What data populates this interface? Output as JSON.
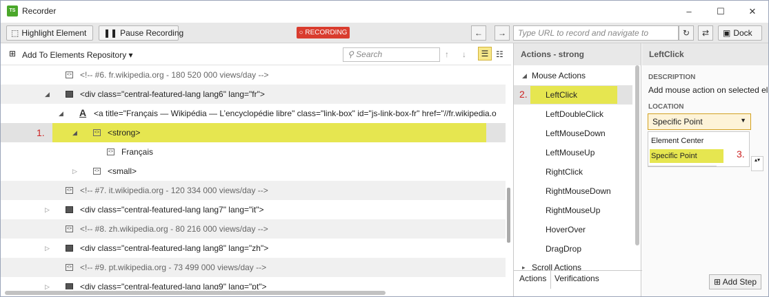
{
  "window": {
    "logo": "TS",
    "title": "Recorder",
    "minimize": "–",
    "maximize": "☐",
    "close": "✕"
  },
  "toolbar": {
    "highlight": "Highlight Element",
    "pause": "Pause Recording",
    "recording": "RECORDING",
    "url_placeholder": "Type URL to record and navigate to",
    "dock": "Dock"
  },
  "elements": {
    "add_repo": "Add To Elements Repository",
    "search_placeholder": "Search",
    "rows": [
      {
        "text": "<!-- #6. fr.wikipedia.org - 180 520 000 views/day -->"
      },
      {
        "text": "<div class=\"central-featured-lang lang6\" lang=\"fr\">"
      },
      {
        "text": "<a title=\"Français — Wikipédia — L’encyclopédie libre\" class=\"link-box\" id=\"js-link-box-fr\" href=\"//fr.wikipedia.o"
      },
      {
        "text": "<strong>",
        "badge": "1."
      },
      {
        "text": "Français"
      },
      {
        "text": "<small>"
      },
      {
        "text": "<!-- #7. it.wikipedia.org - 120 334 000 views/day -->"
      },
      {
        "text": "<div class=\"central-featured-lang lang7\" lang=\"it\">"
      },
      {
        "text": "<!-- #8. zh.wikipedia.org - 80 216 000 views/day -->"
      },
      {
        "text": "<div class=\"central-featured-lang lang8\" lang=\"zh\">"
      },
      {
        "text": "<!-- #9. pt.wikipedia.org - 73 499 000 views/day -->"
      },
      {
        "text": "<div class=\"central-featured-lang lang9\" lang=\"pt\">"
      }
    ]
  },
  "actions": {
    "header": "Actions - strong",
    "group": "Mouse Actions",
    "badge": "2.",
    "items": [
      "LeftClick",
      "LeftDoubleClick",
      "LeftMouseDown",
      "LeftMouseUp",
      "RightClick",
      "RightMouseDown",
      "RightMouseUp",
      "HoverOver",
      "DragDrop"
    ],
    "scroll_group": "Scroll Actions",
    "tab_actions": "Actions",
    "tab_verifications": "Verifications"
  },
  "details": {
    "header": "LeftClick",
    "desc_label": "DESCRIPTION",
    "desc_text": "Add mouse action on selected el",
    "loc_label": "LOCATION",
    "selected": "Specific Point",
    "options": [
      "Element Center",
      "Specific Point"
    ],
    "badge": "3.",
    "add_step": "Add Step"
  },
  "colors": {
    "highlight": "#e6e650",
    "recording": "#d93c2e",
    "badge": "#cc2222"
  }
}
